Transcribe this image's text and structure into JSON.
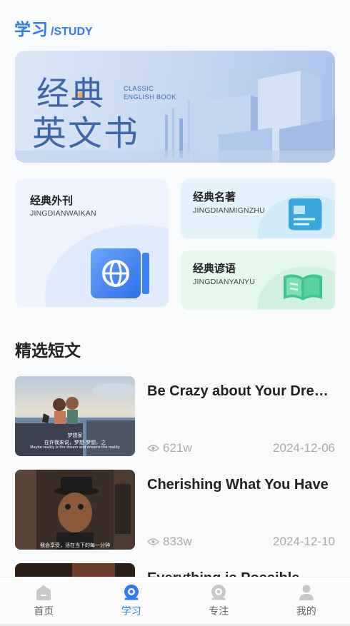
{
  "header": {
    "title_cn": "学习",
    "title_en": "/STUDY"
  },
  "banner": {
    "line1": "经典",
    "line2": "英文书",
    "en_line1": "CLASSIC",
    "en_line2": "ENGLISH BOOK"
  },
  "categories": [
    {
      "title": "经典外刊",
      "subtitle": "JINGDIANWAIKAN",
      "icon": "globe-icon"
    },
    {
      "title": "经典名著",
      "subtitle": "JINGDIANMIGNZHU",
      "icon": "document-icon"
    },
    {
      "title": "经典谚语",
      "subtitle": "JINGDIANYANYU",
      "icon": "open-book-icon"
    }
  ],
  "section": {
    "title": "精选短文"
  },
  "articles": [
    {
      "title": "Be Crazy about Your Dreams",
      "views": "621w",
      "date": "2024-12-06",
      "caption_cn": "在许我来说，梦想·梦想，之",
      "caption_name": "梦想家",
      "caption_en": "Maybe reality is the dream and dreams the reality"
    },
    {
      "title": "Cherishing What You Have",
      "views": "833w",
      "date": "2024-12-10",
      "caption_cn": "我会享受，活在当下的每一分钟"
    },
    {
      "title": "Everything is Possible",
      "views": "",
      "date": ""
    }
  ],
  "tabbar": {
    "items": [
      {
        "label": "首页",
        "icon": "home-icon",
        "active": false
      },
      {
        "label": "学习",
        "icon": "study-icon",
        "active": true
      },
      {
        "label": "专注",
        "icon": "focus-icon",
        "active": false
      },
      {
        "label": "我的",
        "icon": "profile-icon",
        "active": false
      }
    ]
  },
  "colors": {
    "accent": "#2d7cf6",
    "muted": "#aaaaaa"
  }
}
